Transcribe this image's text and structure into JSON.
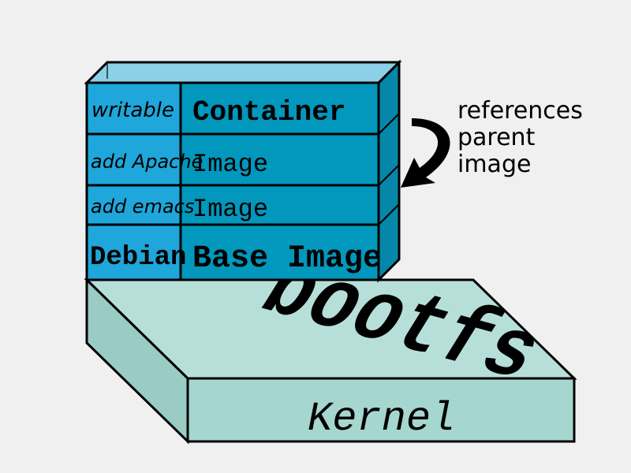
{
  "diagram": {
    "annotation": {
      "line1": "references",
      "line2": "parent",
      "line3": "image"
    },
    "layers": [
      {
        "left": "writable",
        "right": "Container"
      },
      {
        "left": "add Apache",
        "right": "Image"
      },
      {
        "left": "add emacs",
        "right": "Image"
      },
      {
        "left": "Debian",
        "right": "Base Image"
      }
    ],
    "base": {
      "top_label": "bootfs",
      "front_label": "Kernel"
    },
    "colors": {
      "layer_left": "#1fa6da",
      "layer_right": "#0297bc",
      "base_top": "#b7dfda",
      "base_front": "#a6d6d0",
      "container_fill": "#3ab6e0",
      "stroke": "#000000"
    }
  }
}
